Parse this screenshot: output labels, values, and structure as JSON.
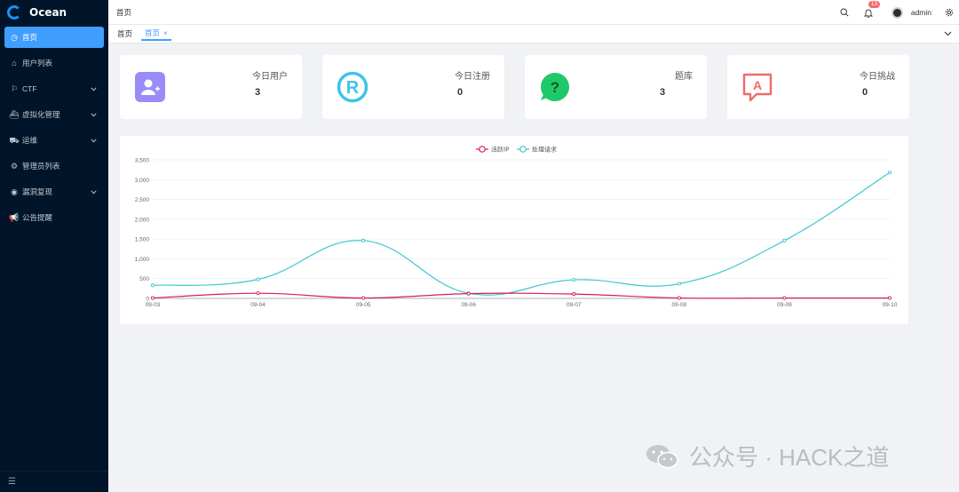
{
  "app": {
    "name": "Ocean"
  },
  "sidebar": {
    "items": [
      {
        "label": "首页",
        "icon": "dashboard-icon",
        "active": true,
        "has_children": false
      },
      {
        "label": "用户列表",
        "icon": "home-icon",
        "active": false,
        "has_children": false
      },
      {
        "label": "CTF",
        "icon": "flag-icon",
        "active": false,
        "has_children": true
      },
      {
        "label": "虚拟化管理",
        "icon": "ship-icon",
        "active": false,
        "has_children": true
      },
      {
        "label": "运维",
        "icon": "truck-icon",
        "active": false,
        "has_children": true
      },
      {
        "label": "管理员列表",
        "icon": "gear-icon",
        "active": false,
        "has_children": false
      },
      {
        "label": "漏洞复现",
        "icon": "aperture-icon",
        "active": false,
        "has_children": true
      },
      {
        "label": "公告提醒",
        "icon": "megaphone-icon",
        "active": false,
        "has_children": false
      }
    ],
    "collapse_icon": "menu-fold-icon"
  },
  "header": {
    "breadcrumb": "首页",
    "notification_count": "13",
    "username": "admin"
  },
  "tabs": {
    "home_label": "首页",
    "active_label": "首页",
    "close_glyph": "×"
  },
  "cards": [
    {
      "label": "今日用户",
      "value": "3",
      "icon": "user-add-icon",
      "color": "#9a8cf7"
    },
    {
      "label": "今日注册",
      "value": "0",
      "icon": "registered-icon",
      "color": "#40c4e8"
    },
    {
      "label": "题库",
      "value": "3",
      "icon": "question-chat-icon",
      "color": "#1fc96a"
    },
    {
      "label": "今日挑战",
      "value": "0",
      "icon": "alert-chat-icon",
      "color": "#f06b6b"
    }
  ],
  "chart_data": {
    "type": "line",
    "categories": [
      "09-03",
      "09-04",
      "09-05",
      "09-06",
      "09-07",
      "09-08",
      "09-09",
      "09-10"
    ],
    "series": [
      {
        "name": "活跃IP",
        "color": "#d81b60",
        "values": [
          10,
          130,
          10,
          120,
          110,
          10,
          10,
          10
        ]
      },
      {
        "name": "处理请求",
        "color": "#3ec7d0",
        "values": [
          330,
          480,
          1460,
          130,
          470,
          370,
          1460,
          3180
        ]
      }
    ],
    "y_ticks": [
      "0",
      "500",
      "1,000",
      "1,500",
      "2,000",
      "2,500",
      "3,000",
      "3,500"
    ],
    "ylim": [
      0,
      3500
    ],
    "smooth": true,
    "grid": true,
    "legend_position": "top-center"
  },
  "watermark": {
    "text": "公众号 · HACK之道"
  }
}
